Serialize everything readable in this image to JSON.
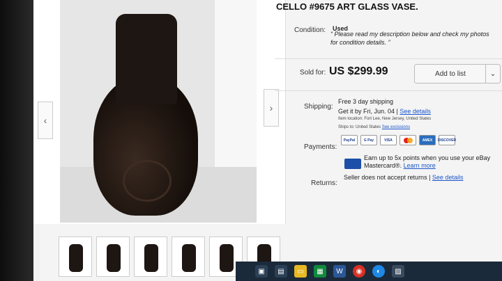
{
  "listing": {
    "title": "CELLO #9675 ART GLASS VASE."
  },
  "condition": {
    "label": "Condition:",
    "value": "Used",
    "description": "“ Please read my description below and check my photos for condition details. ”"
  },
  "price": {
    "label": "Sold for:",
    "amount": "US $299.99",
    "add_to_list": "Add to list",
    "dropdown_icon": "chevron-down-icon"
  },
  "shipping": {
    "label": "Shipping:",
    "main": "Free 3 day shipping",
    "get_it": "Get it by Fri, Jun. 04 |",
    "see_details": "See details",
    "item_location": "Item location:  Fort Lee, New Jersey, United States",
    "ships_to": "Ships to:  United States",
    "see_exclusions": "See exclusions"
  },
  "payments": {
    "label": "Payments:",
    "methods": [
      "PayPal",
      "G Pay",
      "VISA",
      "",
      "AMEX",
      "DISCOVER"
    ],
    "earn_text": "Earn up to 5x points when you use your eBay Mastercard®.",
    "learn_more": "Learn more"
  },
  "returns": {
    "label": "Returns:",
    "value": "Seller does not accept returns |",
    "see_details": "See details"
  },
  "gallery": {
    "prev_icon": "chevron-left-icon",
    "next_icon": "chevron-right-icon",
    "thumbnail_count": 6
  }
}
